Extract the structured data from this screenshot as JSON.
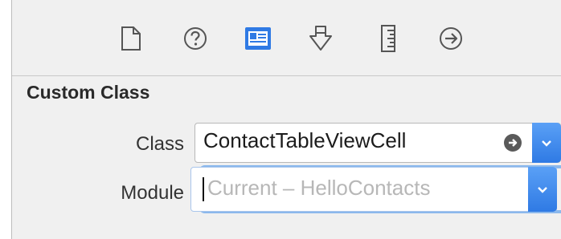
{
  "toolbar": {
    "items": [
      {
        "icon": "file-inspector-icon"
      },
      {
        "icon": "quick-help-icon"
      },
      {
        "icon": "identity-inspector-icon",
        "selected": true
      },
      {
        "icon": "attributes-inspector-icon"
      },
      {
        "icon": "size-inspector-icon"
      },
      {
        "icon": "connections-inspector-icon"
      }
    ],
    "accent_color": "#2f7ae4"
  },
  "custom_class": {
    "section_title": "Custom Class",
    "class_label": "Class",
    "class_value": "ContactTableViewCell",
    "module_label": "Module",
    "module_placeholder": "Current – HelloContacts"
  }
}
